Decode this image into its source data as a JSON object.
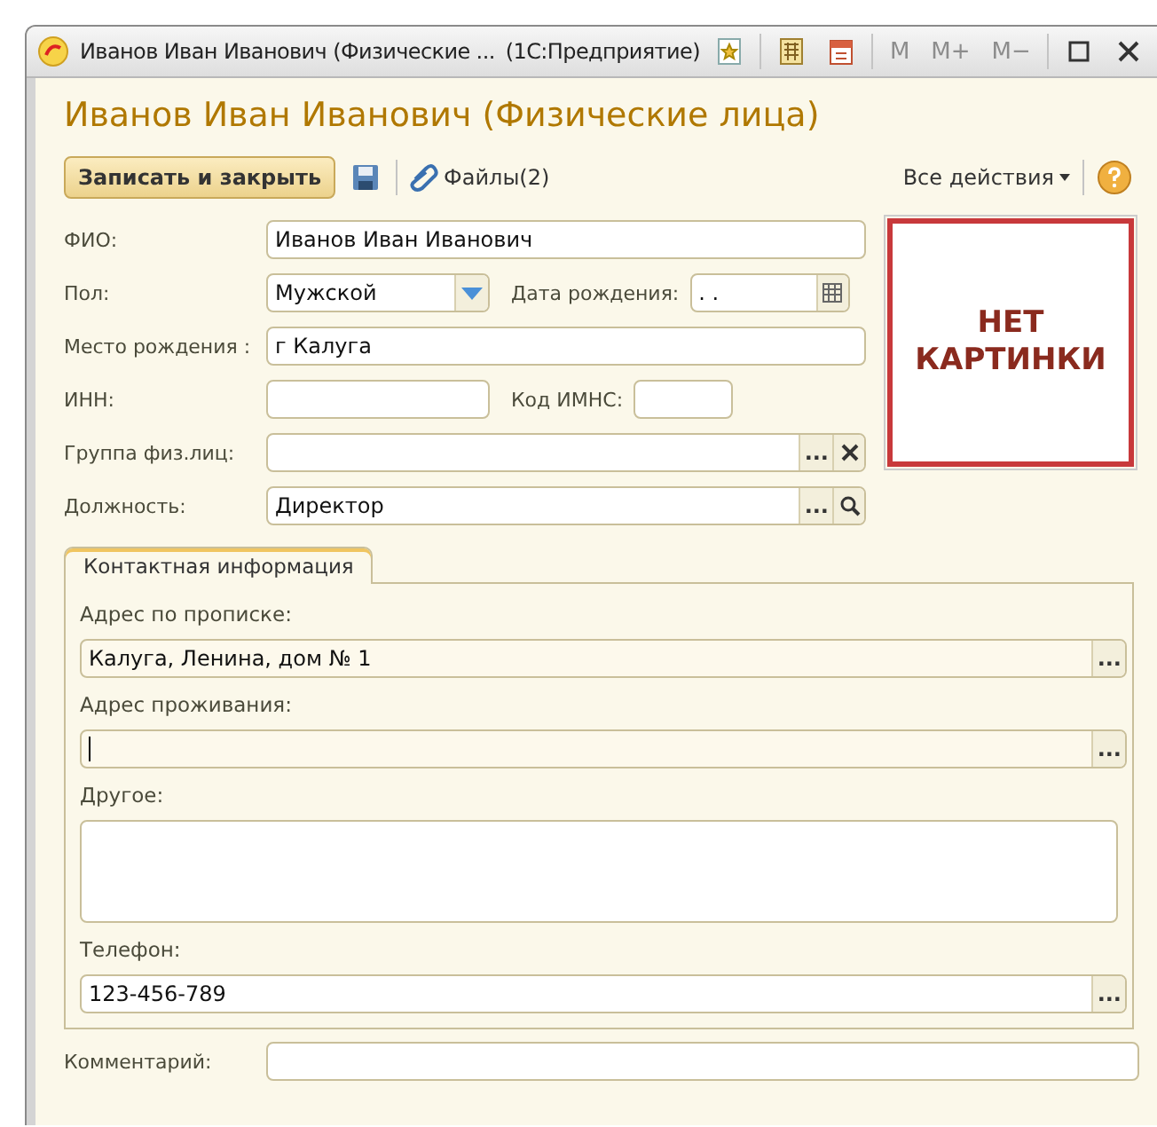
{
  "window": {
    "title": "Иванов Иван Иванович (Физические ...",
    "app": "(1С:Предприятие)",
    "memory_buttons": [
      {
        "label": "M",
        "disabled": true
      },
      {
        "label": "M+",
        "disabled": true
      },
      {
        "label": "M−",
        "disabled": true
      }
    ]
  },
  "heading": "Иванов Иван Иванович (Физические лица)",
  "toolbar": {
    "primary": "Записать и закрыть",
    "files": "Файлы(2)",
    "all_actions": "Все действия"
  },
  "rows": [
    {
      "items": [
        {
          "label": "ФИО:",
          "kind": "text",
          "value": "Иванов Иван Иванович"
        }
      ]
    },
    {
      "items": [
        {
          "label": "Пол:",
          "kind": "select",
          "value": "Мужской"
        },
        {
          "label": "Дата рождения:",
          "kind": "date",
          "value": ". ."
        }
      ]
    },
    {
      "items": [
        {
          "label": "Место рождения :",
          "kind": "text",
          "value": "г Калуга"
        }
      ]
    },
    {
      "items": [
        {
          "label": "ИНН:",
          "kind": "text"
        },
        {
          "label": "Код ИМНС:",
          "kind": "text"
        }
      ]
    },
    {
      "items": [
        {
          "label": "Группа физ.лиц:",
          "kind": "ref",
          "actions": [
            {
              "kind": "choose",
              "label": "..."
            },
            {
              "kind": "clear"
            }
          ]
        }
      ]
    },
    {
      "items": [
        {
          "label": "Должность:",
          "kind": "ref",
          "value": "Директор",
          "actions": [
            {
              "kind": "choose",
              "label": "..."
            },
            {
              "kind": "search"
            }
          ]
        }
      ]
    }
  ],
  "picture": {
    "text": "НЕТ\nКАРТИНКИ"
  },
  "tabs": [
    {
      "label": "Контактная информация",
      "selected": true
    }
  ],
  "contacts": [
    {
      "label": "Адрес по прописке:",
      "kind": "line",
      "value": "Калуга, Ленина, дом № 1",
      "focused": false,
      "action": "..."
    },
    {
      "label": "Адрес проживания:",
      "kind": "line",
      "focused": true,
      "action": "..."
    },
    {
      "label": "Другое:",
      "kind": "area"
    },
    {
      "label": "Телефон:",
      "kind": "line",
      "value": "123-456-789",
      "focused": false,
      "action": "..."
    }
  ],
  "comment": {
    "label": "Комментарий:"
  }
}
